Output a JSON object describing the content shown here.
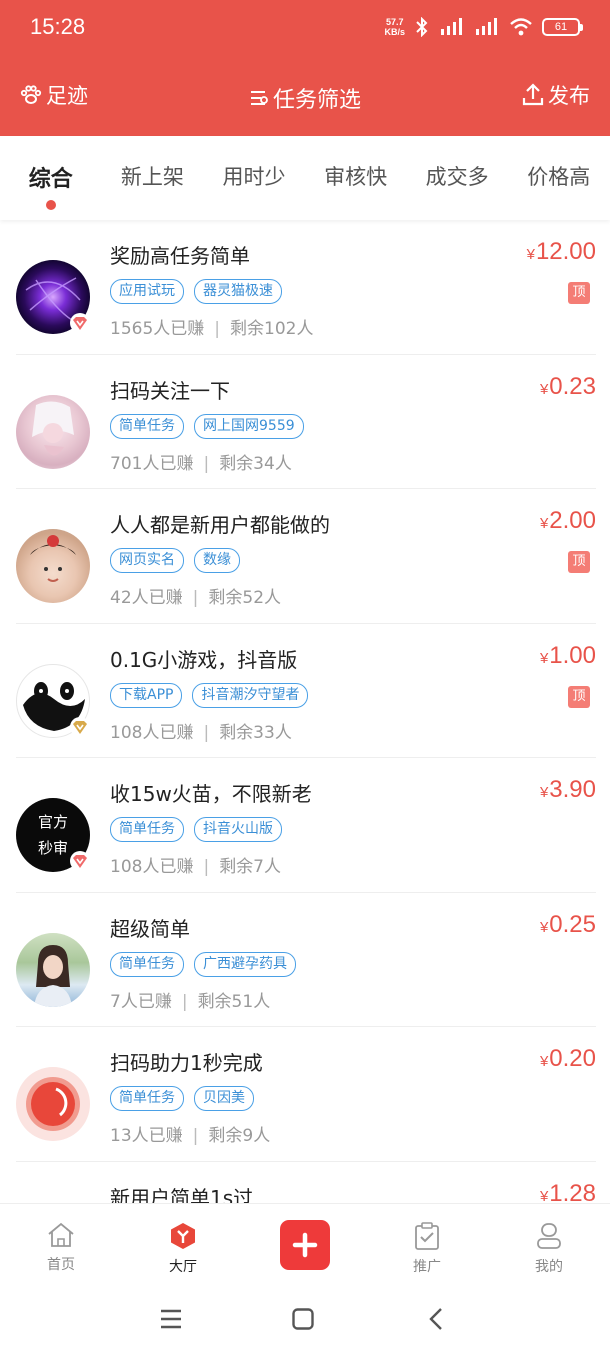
{
  "status": {
    "time": "15:28",
    "speed_value": "57.7",
    "speed_unit": "KB/s",
    "battery": "61"
  },
  "navbar": {
    "left_label": "足迹",
    "title": "任务筛选",
    "right_label": "发布"
  },
  "tabs": [
    {
      "label": "综合",
      "active": true
    },
    {
      "label": "新上架"
    },
    {
      "label": "用时少"
    },
    {
      "label": "审核快"
    },
    {
      "label": "成交多"
    },
    {
      "label": "价格高"
    }
  ],
  "tasks": [
    {
      "title": "奖励高任务简单",
      "tags": [
        "应用试玩",
        "器灵猫极速"
      ],
      "earned": "1565人已赚",
      "remaining": "剩余102人",
      "currency": "¥",
      "price": "12.00",
      "top": "顶",
      "avatar": "galaxy",
      "badge": "red-v-icon"
    },
    {
      "title": "扫码关注一下",
      "tags": [
        "简单任务",
        "网上国网9559"
      ],
      "earned": "701人已赚",
      "remaining": "剩余34人",
      "currency": "¥",
      "price": "0.23",
      "top": "",
      "avatar": "anime",
      "badge": ""
    },
    {
      "title": "人人都是新用户都能做的",
      "tags": [
        "网页实名",
        "数缘"
      ],
      "earned": "42人已赚",
      "remaining": "剩余52人",
      "currency": "¥",
      "price": "2.00",
      "top": "顶",
      "avatar": "child",
      "badge": ""
    },
    {
      "title": "0.1G小游戏，抖音版",
      "tags": [
        "下载APP",
        "抖音潮汐守望者"
      ],
      "earned": "108人已赚",
      "remaining": "剩余33人",
      "currency": "¥",
      "price": "1.00",
      "top": "顶",
      "avatar": "panda",
      "badge": "gold-v-icon"
    },
    {
      "title": "收15w火苗，不限新老",
      "tags": [
        "简单任务",
        "抖音火山版"
      ],
      "earned": "108人已赚",
      "remaining": "剩余7人",
      "currency": "¥",
      "price": "3.90",
      "top": "",
      "avatar": "official",
      "avatar_text_1": "官方",
      "avatar_text_2": "秒审",
      "badge": "red-v-icon"
    },
    {
      "title": "超级简单",
      "tags": [
        "简单任务",
        "广西避孕药具"
      ],
      "earned": "7人已赚",
      "remaining": "剩余51人",
      "currency": "¥",
      "price": "0.25",
      "top": "",
      "avatar": "girl",
      "badge": ""
    },
    {
      "title": "扫码助力1秒完成",
      "tags": [
        "简单任务",
        "贝因美"
      ],
      "earned": "13人已赚",
      "remaining": "剩余9人",
      "currency": "¥",
      "price": "0.20",
      "top": "",
      "avatar": "red-circle",
      "badge": ""
    },
    {
      "title": "新用户简单1s过",
      "tags": [],
      "earned": "",
      "remaining": "",
      "currency": "¥",
      "price": "1.28",
      "top": "",
      "avatar": "none",
      "badge": ""
    }
  ],
  "bottom_nav": [
    {
      "label": "首页",
      "icon": "home-icon"
    },
    {
      "label": "大厅",
      "icon": "hall-icon",
      "active": true
    },
    {
      "label": "",
      "icon": "plus-icon"
    },
    {
      "label": "推广",
      "icon": "clipboard-icon"
    },
    {
      "label": "我的",
      "icon": "user-icon"
    }
  ],
  "colors": {
    "primary": "#e8534a",
    "tag_blue": "#3b8fd6",
    "top_badge": "#f47d75"
  }
}
